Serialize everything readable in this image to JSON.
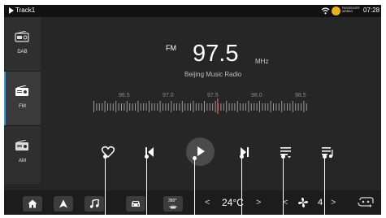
{
  "status_bar": {
    "track": "Track1",
    "passenger_airbag": "PASSENGER AIRBAG",
    "time": "07:28"
  },
  "sources": [
    {
      "label": "DAB",
      "icon": "radio-icon",
      "active": false
    },
    {
      "label": "FM",
      "icon": "radio-icon",
      "active": true
    },
    {
      "label": "AM",
      "icon": "radio-icon",
      "active": false
    }
  ],
  "radio": {
    "band": "FM",
    "frequency": "97.5",
    "unit": "MHz",
    "station": "Beijing Music Radio",
    "dial_labels": [
      "96.5",
      "97.0",
      "97.5",
      "98.0",
      "98.5"
    ]
  },
  "controls": [
    {
      "name": "favorite-button",
      "icon": "heart-icon"
    },
    {
      "name": "previous-button",
      "icon": "skip-previous-icon"
    },
    {
      "name": "play-button",
      "icon": "play-icon"
    },
    {
      "name": "next-button",
      "icon": "skip-next-icon"
    },
    {
      "name": "playlist-button",
      "icon": "list-icon"
    },
    {
      "name": "queue-button",
      "icon": "music-list-icon"
    }
  ],
  "dock": {
    "buttons": [
      "home-icon",
      "navigation-icon",
      "music-icon",
      "car-icon",
      "360-camera-icon"
    ],
    "camera_label": "360°",
    "temperature": "24°C",
    "fan_level": "4",
    "left_chevron": "<",
    "right_chevron": ">"
  },
  "colors": {
    "accent": "#3a9ad9",
    "dial_marker": "#e0383d",
    "airbag": "#e8b020"
  }
}
